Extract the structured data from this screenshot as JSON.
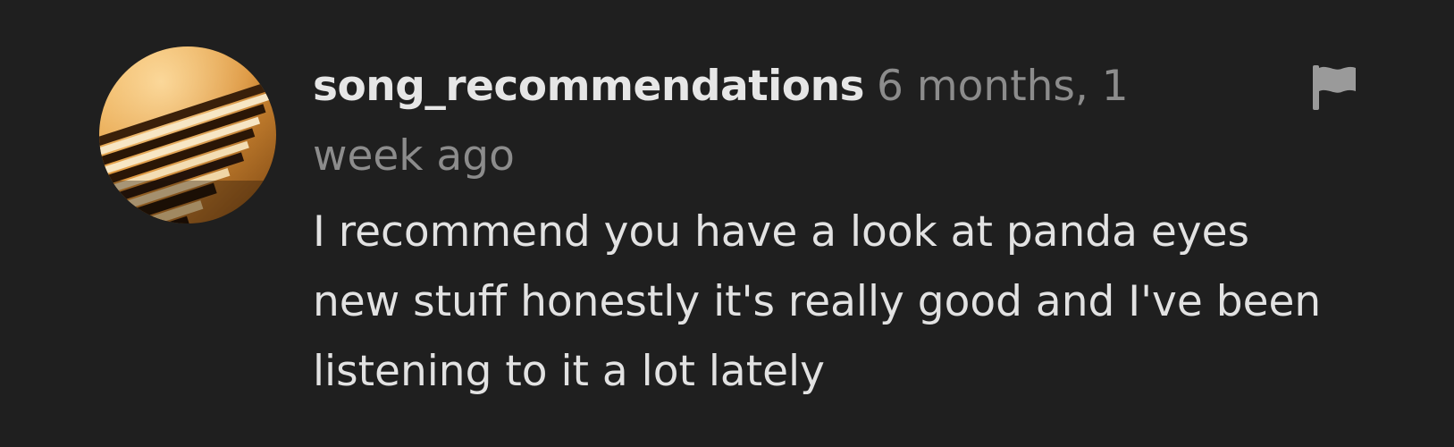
{
  "comment": {
    "username": "song_recommendations",
    "timestamp": "6 months, 1 week ago",
    "text": "I recommend you have a look at panda eyes new stuff honestly it's really good and I've been listening to it a lot lately",
    "avatar_icon": "piano-keys-avatar",
    "flag_icon": "flag-icon"
  },
  "colors": {
    "background": "#1f1f1f",
    "username": "#e6e6e6",
    "timestamp": "#8c8c8c",
    "text": "#e2e2e2",
    "flag": "#9a9a9a"
  }
}
